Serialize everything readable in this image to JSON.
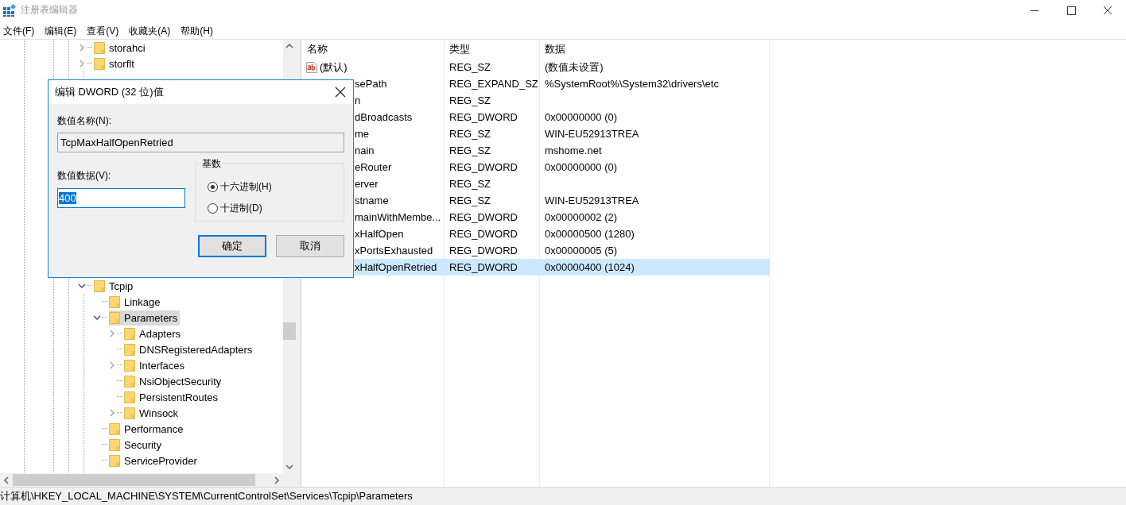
{
  "window": {
    "title": "注册表编辑器"
  },
  "menu": [
    "文件(F)",
    "编辑(E)",
    "查看(V)",
    "收藏夹(A)",
    "帮助(H)"
  ],
  "tree": {
    "top_items": [
      {
        "label": "storahci",
        "expanded": false,
        "selected": false
      },
      {
        "label": "storflt",
        "expanded": false,
        "selected": false
      }
    ],
    "items": [
      {
        "label": "Tcpip",
        "expanded": true,
        "selected": false,
        "children": [
          {
            "label": "Linkage",
            "selected": false
          },
          {
            "label": "Parameters",
            "expanded": true,
            "selected": true,
            "children": [
              {
                "label": "Adapters",
                "expanded": false,
                "selected": false
              },
              {
                "label": "DNSRegisteredAdapters",
                "selected": false
              },
              {
                "label": "Interfaces",
                "expanded": false,
                "selected": false
              },
              {
                "label": "NsiObjectSecurity",
                "selected": false
              },
              {
                "label": "PersistentRoutes",
                "selected": false
              },
              {
                "label": "Winsock",
                "expanded": false,
                "selected": false
              }
            ]
          },
          {
            "label": "Performance",
            "selected": false
          },
          {
            "label": "Security",
            "selected": false
          },
          {
            "label": "ServiceProvider",
            "selected": false
          }
        ]
      }
    ]
  },
  "values": {
    "columns": [
      "名称",
      "类型",
      "数据"
    ],
    "rows": [
      {
        "name": "(默认)",
        "covered": false,
        "type": "REG_SZ",
        "data": "(数值未设置)",
        "selected": false
      },
      {
        "name": "sePath",
        "covered": true,
        "type": "REG_EXPAND_SZ",
        "data": "%SystemRoot%\\System32\\drivers\\etc",
        "selected": false
      },
      {
        "name": "n",
        "covered": true,
        "type": "REG_SZ",
        "selected": false
      },
      {
        "name": "dBroadcasts",
        "covered": true,
        "type": "REG_DWORD",
        "data": "0x00000000 (0)",
        "selected": false
      },
      {
        "name": "me",
        "covered": true,
        "type": "REG_SZ",
        "data": "WIN-EU52913TREA",
        "selected": false
      },
      {
        "name": "nain",
        "covered": true,
        "type": "REG_SZ",
        "data": "mshome.net",
        "selected": false
      },
      {
        "name": "eRouter",
        "covered": true,
        "type": "REG_DWORD",
        "data": "0x00000000 (0)",
        "selected": false
      },
      {
        "name": "erver",
        "covered": true,
        "type": "REG_SZ",
        "selected": false
      },
      {
        "name": "stname",
        "covered": true,
        "type": "REG_SZ",
        "data": "WIN-EU52913TREA",
        "selected": false
      },
      {
        "name": "mainWithMembe...",
        "covered": true,
        "type": "REG_DWORD",
        "data": "0x00000002 (2)",
        "selected": false
      },
      {
        "name": "xHalfOpen",
        "covered": true,
        "type": "REG_DWORD",
        "data": "0x00000500 (1280)",
        "selected": false
      },
      {
        "name": "xPortsExhausted",
        "covered": true,
        "type": "REG_DWORD",
        "data": "0x00000005 (5)",
        "selected": false
      },
      {
        "name": "xHalfOpenRetried",
        "covered": true,
        "type": "REG_DWORD",
        "data": "0x00000400 (1024)",
        "selected": true
      }
    ]
  },
  "status_bar": "计算机\\HKEY_LOCAL_MACHINE\\SYSTEM\\CurrentControlSet\\Services\\Tcpip\\Parameters",
  "dialog": {
    "title": "编辑 DWORD (32 位)值",
    "name_label": "数值名称(N):",
    "name_value": "TcpMaxHalfOpenRetried",
    "data_label": "数值数据(V):",
    "data_value": "400",
    "base_label": "基数",
    "bases": [
      {
        "label": "十六进制(H)",
        "selected": true
      },
      {
        "label": "十进制(D)",
        "selected": false
      }
    ],
    "buttons": [
      {
        "label": "确定",
        "default": true
      },
      {
        "label": "取消",
        "default": false
      }
    ]
  }
}
